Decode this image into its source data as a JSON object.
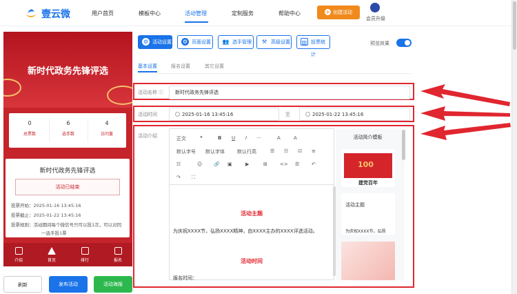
{
  "brand": {
    "name": "壹云微"
  },
  "nav": [
    {
      "label": "用户首页"
    },
    {
      "label": "模板中心"
    },
    {
      "label": "活动管理"
    },
    {
      "label": "定制服务"
    },
    {
      "label": "帮助中心"
    }
  ],
  "header": {
    "create_label": "创建活动",
    "vip_label": "会员升级"
  },
  "preview": {
    "banner_title": "新时代政务先锋评选",
    "stats": [
      {
        "value": "0",
        "label": "总票数"
      },
      {
        "value": "6",
        "label": "选手数"
      },
      {
        "value": "4",
        "label": "访问量"
      }
    ],
    "card_title": "新时代政务先锋评选",
    "status": "活动已结束",
    "vote_start": "投票开始：2025-01-16 13:45:16",
    "vote_end": "投票截止：2025-01-22 13:45:16",
    "rule_1": "投票规则：活动期间每个微信号只可以投1次，可以对同",
    "rule_2": "一选手投1票",
    "tabs": [
      {
        "label": "介绍"
      },
      {
        "label": "首页"
      },
      {
        "label": "排行"
      },
      {
        "label": "报名"
      }
    ]
  },
  "bottom_buttons": {
    "refresh": "刷新",
    "publish": "发布活动",
    "poster": "活动海报"
  },
  "toolbar": [
    {
      "label": "活动设置"
    },
    {
      "label": "页面设置"
    },
    {
      "label": "选手管理"
    },
    {
      "label": "高级设置"
    },
    {
      "label": "投票统计"
    }
  ],
  "preview_toggle": {
    "label": "预览效果",
    "on": true
  },
  "subtabs": [
    {
      "label": "基本设置"
    },
    {
      "label": "报名设置"
    },
    {
      "label": "其它设置"
    }
  ],
  "form": {
    "name_label": "活动名称 ⓘ",
    "name_value": "新时代政务先锋评选",
    "time_label": "活动时间",
    "start_time": "2025-01-16 13:45:16",
    "to": "至",
    "end_time": "2025-01-22 13:45:16",
    "intro_label": "活动介绍"
  },
  "editor": {
    "row1": [
      "正文",
      "❝",
      "B",
      "U",
      "I",
      "···",
      "A",
      "A"
    ],
    "row2": [
      "默认字号",
      "默认字体",
      "默认行高",
      "☰",
      "☷",
      "☑",
      "≡"
    ],
    "row3": [
      "☷",
      "☺",
      "🔗",
      "▣",
      "▶",
      "⊞",
      "<>",
      "☰",
      "↶"
    ],
    "row4": [
      "↷",
      "⛶"
    ],
    "heading_1": "活动主题",
    "body_1": "为庆祝XXXX节，弘扬XXXX精神，由XXXX主办的XXXX评选活动。",
    "heading_2": "活动时间",
    "body_2": "报名时间："
  },
  "templates": {
    "title": "活动简介模板",
    "card1_text": "建党百年",
    "card1_badge": "100",
    "card2_title": "活动主题",
    "card2_text": "为庆祝XXXX节，弘扬"
  },
  "colors": {
    "accent": "#1a73e8",
    "brand_red": "#c5242b",
    "orange": "#f08a1c",
    "highlight_red": "#e0262f",
    "green": "#2db84d"
  }
}
